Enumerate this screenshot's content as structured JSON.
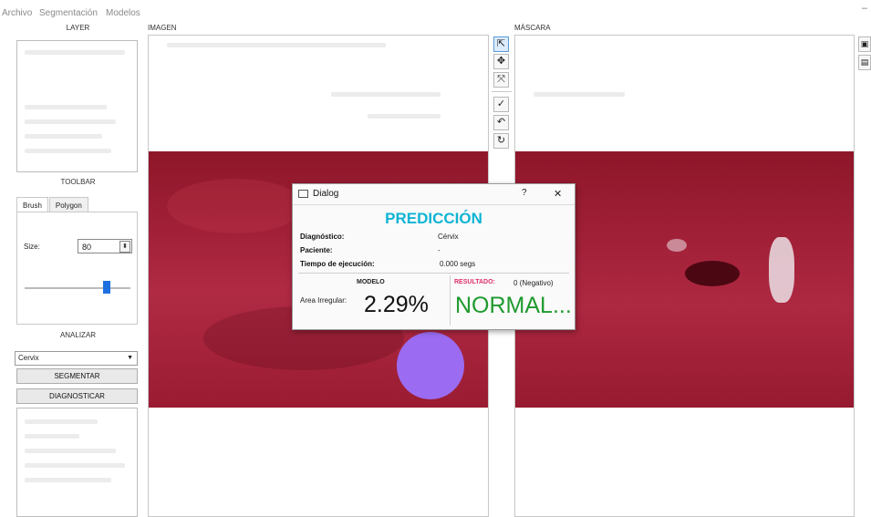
{
  "menu": {
    "items": [
      "Archivo",
      "Segmentación",
      "Modelos"
    ],
    "minimize": "–"
  },
  "left": {
    "layer_header": "LAYER",
    "toolbar_header": "TOOLBAR",
    "tabs": [
      "Brush",
      "Polygon"
    ],
    "size_label": "Size:",
    "size_value": "80",
    "slider_fraction": 0.78,
    "analyze_header": "ANALIZAR",
    "combo_value": "Cervix",
    "segment_button": "SEGMENTAR",
    "diagnose_button": "DIAGNOSTICAR"
  },
  "image_panel": {
    "header": "IMAGEN"
  },
  "mask_panel": {
    "header": "MÁSCARA"
  },
  "tools": [
    "pointer-icon",
    "move-icon",
    "fit-icon",
    "check-icon",
    "undo-icon",
    "redo-icon"
  ],
  "side_tools": [
    "image-icon",
    "save-icon"
  ],
  "dialog": {
    "title": "Dialog",
    "help": "?",
    "close": "✕",
    "heading": "PREDICCIÓN",
    "heading_color": "#0fb4d4",
    "fields": [
      {
        "label": "Diagnóstico:",
        "value": "Cérvix"
      },
      {
        "label": "Paciente:",
        "value": "-"
      },
      {
        "label": "Tiempo de ejecución:",
        "value": "0.000 segs"
      }
    ],
    "model_header": "MODELO",
    "area_label": "Area Irregular:",
    "area_value": "2.29",
    "area_unit": "%",
    "result_label": "RESULTADO:",
    "result_label_color": "#e0306a",
    "result_code": "0 (Negativo)",
    "result_text": "NORMAL...",
    "result_color": "#1f9a2e"
  },
  "colors": {
    "tissue": "#9c1d33",
    "brush": "#9b6cf2"
  }
}
